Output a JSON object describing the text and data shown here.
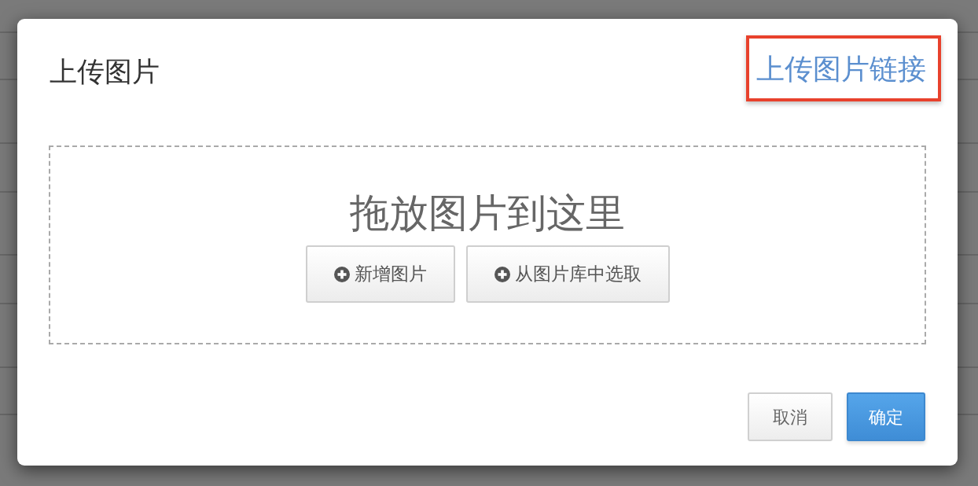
{
  "dialog": {
    "title": "上传图片",
    "link": {
      "label": "上传图片链接",
      "highlighted": true
    }
  },
  "dropzone": {
    "prompt": "拖放图片到这里",
    "buttons": [
      {
        "label": "新增图片"
      },
      {
        "label": "从图片库中选取"
      }
    ]
  },
  "footer": {
    "buttons": [
      {
        "label": "取消",
        "kind": "default"
      },
      {
        "label": "确定",
        "kind": "primary"
      }
    ]
  }
}
